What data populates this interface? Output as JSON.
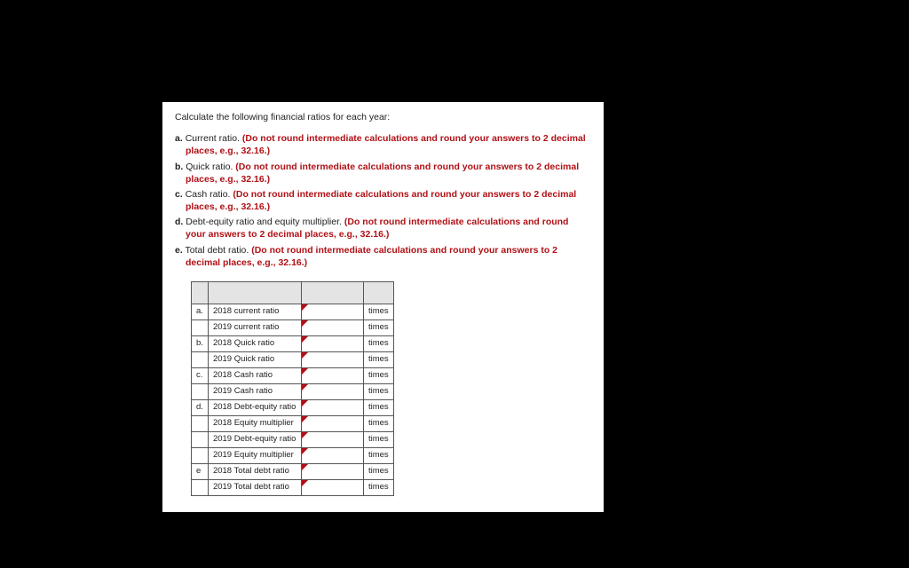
{
  "intro": "Calculate the following financial ratios for each year:",
  "instruction_common": "(Do not round intermediate calculations and round your answers to 2 decimal places, e.g., 32.16.)",
  "questions": [
    {
      "letter": "a.",
      "label": "Current ratio."
    },
    {
      "letter": "b.",
      "label": "Quick ratio."
    },
    {
      "letter": "c.",
      "label": "Cash ratio."
    },
    {
      "letter": "d.",
      "label": "Debt-equity ratio and equity multiplier."
    },
    {
      "letter": "e.",
      "label": "Total debt ratio."
    }
  ],
  "unit": "times",
  "rows": [
    {
      "letter": "a.",
      "label": "2018 current ratio"
    },
    {
      "letter": "",
      "label": "2019 current ratio"
    },
    {
      "letter": "b.",
      "label": "2018 Quick ratio"
    },
    {
      "letter": "",
      "label": "2019 Quick ratio"
    },
    {
      "letter": "c.",
      "label": "2018 Cash ratio"
    },
    {
      "letter": "",
      "label": "2019 Cash ratio"
    },
    {
      "letter": "d.",
      "label": "2018 Debt-equity ratio"
    },
    {
      "letter": "",
      "label": "2018 Equity multiplier"
    },
    {
      "letter": "",
      "label": "2019 Debt-equity ratio"
    },
    {
      "letter": "",
      "label": "2019 Equity multiplier"
    },
    {
      "letter": "e",
      "label": "2018 Total debt ratio"
    },
    {
      "letter": "",
      "label": "2019 Total debt ratio"
    }
  ]
}
